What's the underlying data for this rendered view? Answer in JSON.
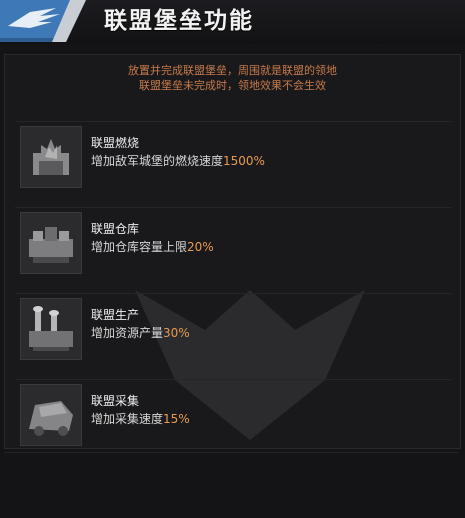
{
  "header": {
    "title": "联盟堡垒功能"
  },
  "description": {
    "line1": "放置并完成联盟堡垒，周围就是联盟的领地",
    "line2": "联盟堡垒未完成时，领地效果不会生效"
  },
  "features": [
    {
      "name": "联盟燃烧",
      "desc": "增加敌军城堡的燃烧速度",
      "value": "1500%",
      "icon": "burning-fortress-icon"
    },
    {
      "name": "联盟仓库",
      "desc": "增加仓库容量上限",
      "value": "20%",
      "icon": "warehouse-icon"
    },
    {
      "name": "联盟生产",
      "desc": "增加资源产量",
      "value": "30%",
      "icon": "production-icon"
    },
    {
      "name": "联盟采集",
      "desc": "增加采集速度",
      "value": "15%",
      "icon": "gathering-icon"
    }
  ],
  "colors": {
    "accent": "#e89a52",
    "description": "#c77a4a",
    "badge": "#3b6fa8"
  }
}
